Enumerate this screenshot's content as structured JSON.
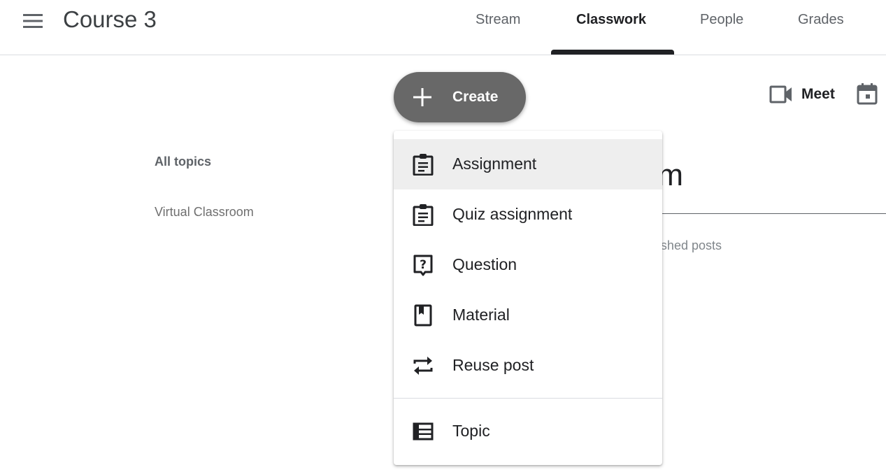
{
  "header": {
    "course_title": "Course 3",
    "tabs": [
      {
        "label": "Stream"
      },
      {
        "label": "Classwork",
        "active": true
      },
      {
        "label": "People"
      },
      {
        "label": "Grades"
      }
    ]
  },
  "toolbar": {
    "create_label": "Create",
    "meet_label": "Meet"
  },
  "topics": {
    "heading": "All topics",
    "items": [
      "Virtual Classroom"
    ]
  },
  "background": {
    "section_title": "Virtual Classroom",
    "posts_text": "No published posts"
  },
  "create_menu": {
    "items": [
      {
        "label": "Assignment",
        "icon": "assignment-icon",
        "highlighted": true
      },
      {
        "label": "Quiz assignment",
        "icon": "quiz-assignment-icon"
      },
      {
        "label": "Question",
        "icon": "question-icon"
      },
      {
        "label": "Material",
        "icon": "material-icon"
      },
      {
        "label": "Reuse post",
        "icon": "reuse-post-icon"
      },
      {
        "label": "Topic",
        "icon": "topic-icon"
      }
    ]
  },
  "colors": {
    "create_button_bg": "#686868",
    "menu_highlight": "#eeeeee",
    "tab_indicator": "#202124"
  }
}
